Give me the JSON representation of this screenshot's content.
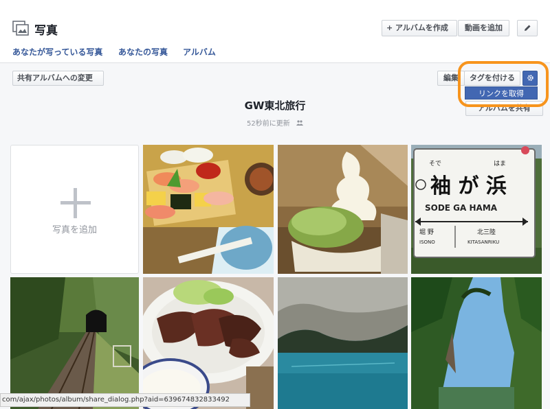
{
  "header": {
    "title": "写真",
    "create_album_label": "+ アルバムを作成",
    "add_video_label": "動画を追加",
    "edit_icon": "pencil-icon"
  },
  "nav": {
    "tab_tagged": "あなたが写っている写真",
    "tab_yours": "あなたの写真",
    "tab_albums": "アルバム"
  },
  "toolbar": {
    "shared_album_label": "共有アルバムへの変更",
    "edit_label": "編集",
    "tag_label": "タグを付ける",
    "gear_icon": "gear-icon",
    "menu_get_link": "リンクを取得",
    "hidden_button_label": "アルバムを共有"
  },
  "album": {
    "title": "GW東北旅行",
    "updated": "52秒前に更新",
    "privacy_icon": "friends-icon"
  },
  "add_tile": {
    "label": "写真を追加"
  },
  "photos": [
    {
      "name": "sushi"
    },
    {
      "name": "soft-serve"
    },
    {
      "name": "station-sign",
      "sign_kanji": "袖 が 浜",
      "sign_furigana_left": "そで",
      "sign_furigana_right": "はま",
      "sign_romaji": "SODE GA HAMA",
      "sign_left_station": "堀 野",
      "sign_left_romaji": "ISONO",
      "sign_right_station": "北三陸",
      "sign_right_romaji": "KITASANRIKU"
    },
    {
      "name": "railway-tunnel"
    },
    {
      "name": "gyutan"
    },
    {
      "name": "cave-water"
    },
    {
      "name": "gorge"
    }
  ],
  "status_bar": {
    "url": "com/ajax/photos/album/share_dialog.php?aid=639674832833492"
  },
  "colors": {
    "highlight": "#f7941d",
    "brand": "#4267b2",
    "link": "#365899"
  }
}
